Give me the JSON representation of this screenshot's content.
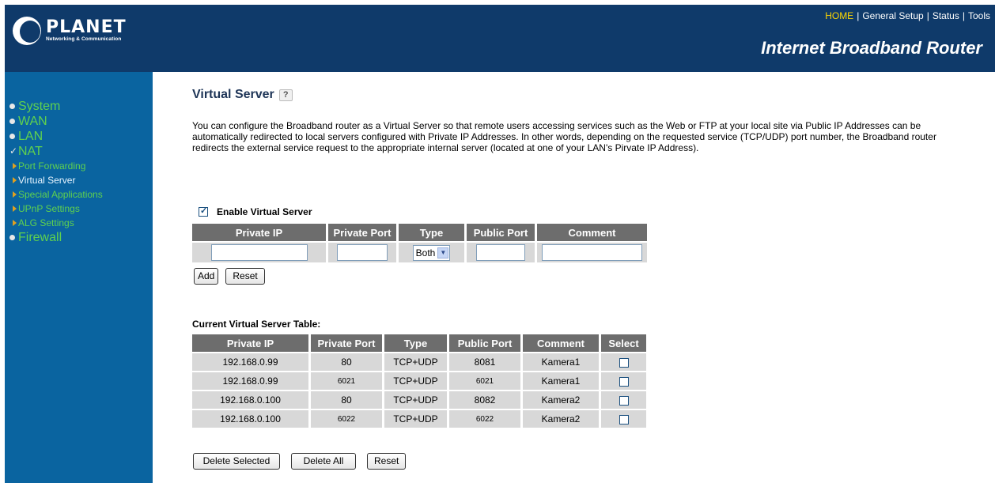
{
  "header": {
    "logo_name": "PLANET",
    "logo_tagline": "Networking & Communication",
    "nav": [
      "HOME",
      "General Setup",
      "Status",
      "Tools"
    ],
    "nav_separator": "|",
    "title": "Internet Broadband Router",
    "bg_color": "#0f3a6a",
    "active_nav_color": "#ffd700"
  },
  "sidebar": {
    "bg_color": "#0a64a0",
    "items": [
      "System",
      "WAN",
      "LAN",
      "NAT"
    ],
    "nat_subitems": [
      "Port Forwarding",
      "Virtual Server",
      "Special Applications",
      "UPnP Settings",
      "ALG Settings"
    ],
    "last_item": "Firewall",
    "icons": {
      "bullet": "bullet-dot-icon",
      "checked": "checkmark-icon",
      "sub": "triangle-arrow-icon"
    }
  },
  "main": {
    "title": "Virtual Server",
    "help_icon": "help-icon",
    "description": "You can configure the Broadband router as a Virtual Server so that remote users accessing services such as the Web or FTP at your local site via Public IP Addresses can be automatically redirected to local servers configured with Private IP Addresses. In other words, depending on the requested service (TCP/UDP) port number, the Broadband router redirects the external service request to the appropriate internal server (located at one of your LAN's Pirvate IP Address).",
    "enable_label": "Enable Virtual Server",
    "enable_checked": true
  },
  "add_form": {
    "headers": [
      "Private IP",
      "Private Port",
      "Type",
      "Public Port",
      "Comment"
    ],
    "values": {
      "private_ip": "",
      "private_port": "",
      "type": "Both",
      "public_port": "",
      "comment": ""
    },
    "add_label": "Add",
    "reset_label": "Reset"
  },
  "table": {
    "title": "Current Virtual Server Table:",
    "headers": [
      "Private IP",
      "Private Port",
      "Type",
      "Public Port",
      "Comment",
      "Select"
    ],
    "rows": [
      {
        "ip": "192.168.0.99",
        "private_port": "80",
        "type": "TCP+UDP",
        "public_port": "8081",
        "comment": "Kamera1"
      },
      {
        "ip": "192.168.0.99",
        "private_port": "6021",
        "type": "TCP+UDP",
        "public_port": "6021",
        "comment": "Kamera1"
      },
      {
        "ip": "192.168.0.100",
        "private_port": "80",
        "type": "TCP+UDP",
        "public_port": "8082",
        "comment": "Kamera2"
      },
      {
        "ip": "192.168.0.100",
        "private_port": "6022",
        "type": "TCP+UDP",
        "public_port": "6022",
        "comment": "Kamera2"
      }
    ],
    "delete_selected_label": "Delete Selected",
    "delete_all_label": "Delete All",
    "reset_label": "Reset"
  }
}
